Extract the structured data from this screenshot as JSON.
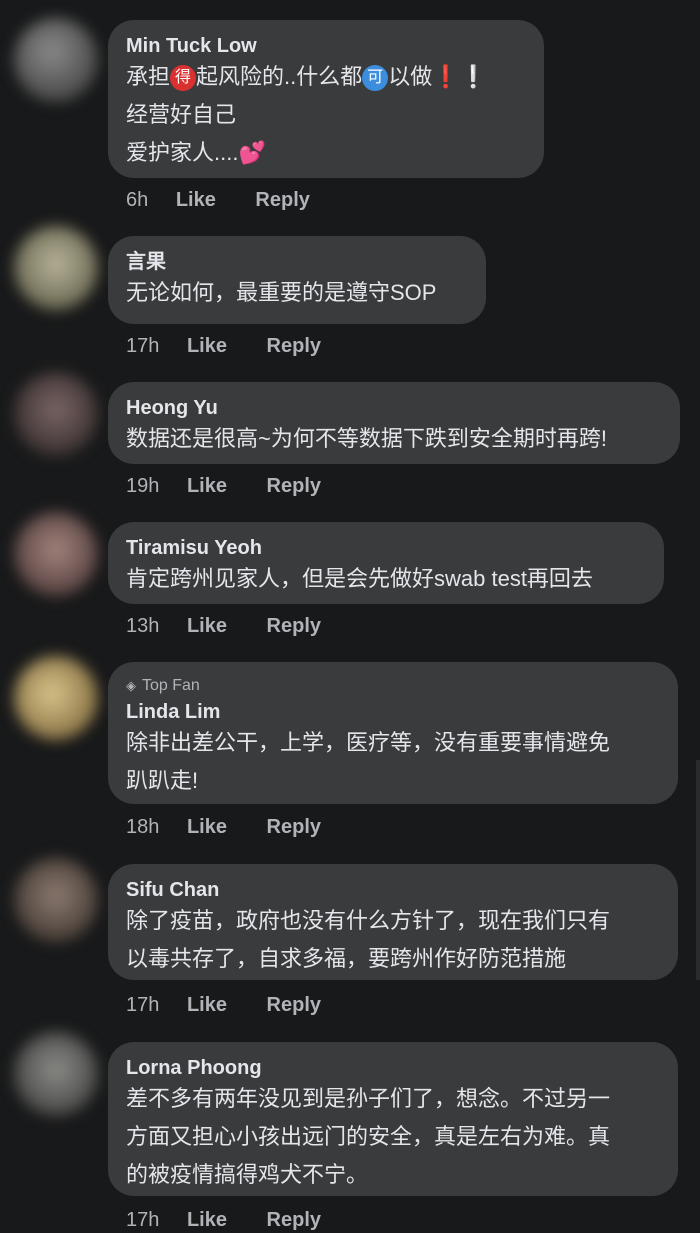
{
  "comments": [
    {
      "author": "Min Tuck  Low",
      "lines": [
        "承担",
        "得",
        "起风险的..什么都",
        "可",
        "以做",
        "❗",
        "❕",
        "经营好自己",
        "爱护家人....",
        "💕"
      ],
      "time": "6h",
      "like": "Like",
      "reply": "Reply"
    },
    {
      "author": "言果",
      "lines": [
        "无论如何，最重要的是遵守SOP"
      ],
      "time": "17h",
      "like": "Like",
      "reply": "Reply"
    },
    {
      "author": "Heong Yu",
      "lines": [
        "数据还是很高~为何不等数据下跌到安全期时再跨!"
      ],
      "time": "19h",
      "like": "Like",
      "reply": "Reply"
    },
    {
      "author": "Tiramisu Yeoh",
      "lines": [
        "肯定跨州见家人，但是会先做好swab test再回去"
      ],
      "time": "13h",
      "like": "Like",
      "reply": "Reply"
    },
    {
      "badge": "Top Fan",
      "author": "Linda Lim",
      "lines": [
        "除非出差公干，上学，医疗等，没有重要事情避免",
        "趴趴走!"
      ],
      "time": "18h",
      "like": "Like",
      "reply": "Reply"
    },
    {
      "author": "Sifu Chan",
      "lines": [
        "除了疫苗，政府也没有什么方针了，现在我们只有",
        "以毒共存了，自求多福，要跨州作好防范措施"
      ],
      "time": "17h",
      "like": "Like",
      "reply": "Reply"
    },
    {
      "author": "Lorna Phoong",
      "lines": [
        "差不多有两年没见到是孙子们了，想念。不过另一",
        "方面又担心小孩出远门的安全，真是左右为难。真",
        "的被疫情搞得鸡犬不宁。"
      ],
      "time": "17h",
      "like": "Like",
      "reply": "Reply"
    }
  ],
  "colors": {
    "background": "#18191a",
    "bubble": "#3a3b3c",
    "text": "#e4e6eb",
    "meta": "#b0b3b8"
  }
}
